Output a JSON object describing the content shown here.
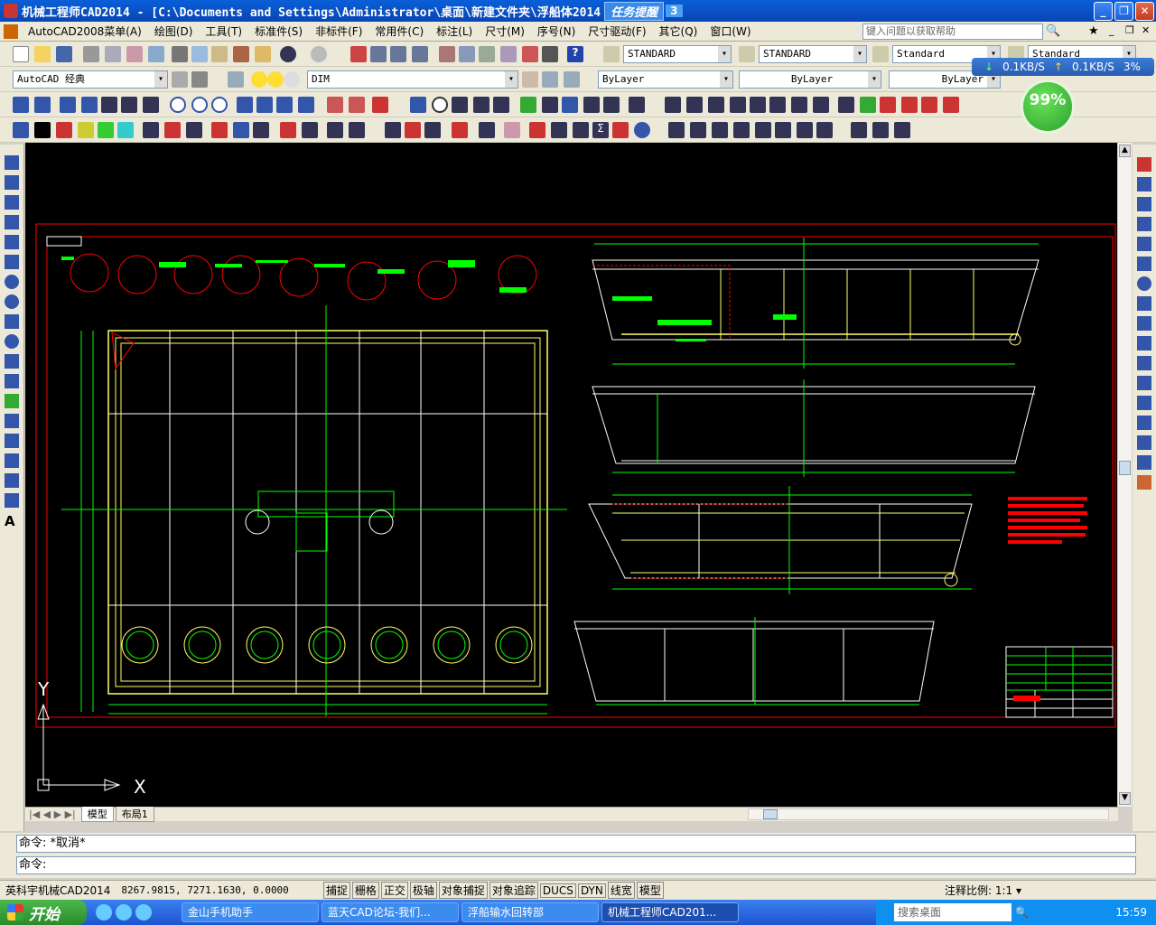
{
  "window": {
    "title": "机械工程师CAD2014 - [C:\\Documents and Settings\\Administrator\\桌面\\新建文件夹\\浮船体2014",
    "task_reminder": "任务提醒",
    "task_count": "3"
  },
  "menu": {
    "items": [
      "AutoCAD2008菜单(A)",
      "绘图(D)",
      "工具(T)",
      "标准件(S)",
      "非标件(F)",
      "常用件(C)",
      "标注(L)",
      "尺寸(M)",
      "序号(N)",
      "尺寸驱动(F)",
      "其它(Q)",
      "窗口(W)"
    ],
    "help_placeholder": "键入问题以获取帮助"
  },
  "toolbars": {
    "text_style": "STANDARD",
    "dim_style": "STANDARD",
    "table_style": "Standard",
    "multileader_style": "Standard",
    "workspace": "AutoCAD 经典",
    "layer": "DIM",
    "color": "ByLayer",
    "linetype": "ByLayer",
    "lineweight": "ByLayer"
  },
  "network": {
    "down": "0.1KB/S",
    "up": "0.1KB/S",
    "cpu": "3%"
  },
  "battery": {
    "percent": "99%"
  },
  "layout_tabs": [
    "模型",
    "布局1"
  ],
  "command": {
    "history": "命令: *取消*",
    "prompt": "命令:"
  },
  "status": {
    "app_name": "英科宇机械CAD2014",
    "coords": "8267.9815, 7271.1630, 0.0000",
    "toggles": [
      "捕捉",
      "栅格",
      "正交",
      "极轴",
      "对象捕捉",
      "对象追踪",
      "DUCS",
      "DYN",
      "线宽",
      "模型"
    ],
    "annotation_scale_label": "注释比例:",
    "annotation_scale": "1:1"
  },
  "taskbar": {
    "start": "开始",
    "buttons": [
      "金山手机助手",
      "蓝天CAD论坛-我们...",
      "浮船输水回转部",
      "机械工程师CAD201..."
    ],
    "search_placeholder": "搜索桌面",
    "clock": "15:59"
  },
  "drawing": {
    "ucs_x": "X",
    "ucs_y": "Y"
  },
  "colors": {
    "canvas": "#000000",
    "border_red": "#ff0000",
    "yellow": "#ffff66",
    "green": "#00ff00",
    "white": "#ffffff"
  }
}
